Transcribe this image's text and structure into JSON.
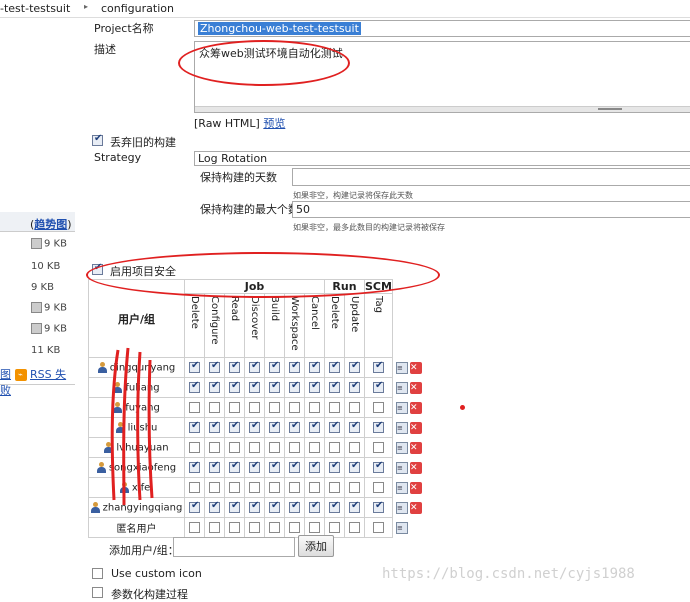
{
  "breadcrumb": {
    "project": "-test-testsuit",
    "page": "configuration"
  },
  "form": {
    "project_label": "Project名称",
    "project_value": "Zhongchou-web-test-testsuit",
    "desc_label": "描述",
    "desc_value": "众筹web测试环境自动化测试",
    "raw_html": "[Raw HTML]",
    "preview": "预览",
    "discard_label": "丢弃旧的构建",
    "strategy_label": "Strategy",
    "strategy_value": "Log Rotation",
    "days_label": "保持构建的天数",
    "days_value": "",
    "days_hint": "如果非空，构建记录将保存此天数",
    "max_label": "保持构建的最大个数",
    "max_value": "50",
    "max_hint": "如果非空，最多此数目的构建记录将被保存",
    "security_label": "启用项目安全",
    "add_user_label": "添加用户/组：",
    "add_button": "添加",
    "custom_icon_label": "Use custom icon",
    "param_label": "参数化构建过程"
  },
  "sidebar": {
    "trend": "趋势图",
    "sizes": [
      "9 KB",
      "10 KB",
      "9 KB",
      "9 KB",
      "9 KB",
      "11 KB"
    ],
    "legend": "图",
    "rss": "RSS 失败"
  },
  "matrix": {
    "user_header": "用户/组",
    "groups": [
      "Job",
      "Run",
      "SCM"
    ],
    "columns": [
      "Delete",
      "Configure",
      "Read",
      "Discover",
      "Build",
      "Workspace",
      "Cancel",
      "Delete",
      "Update",
      "Tag"
    ],
    "rows": [
      {
        "name": "dingqunyang",
        "checks": [
          1,
          1,
          1,
          1,
          1,
          1,
          1,
          1,
          1,
          1
        ]
      },
      {
        "name": "fuliang",
        "checks": [
          1,
          1,
          1,
          1,
          1,
          1,
          1,
          1,
          1,
          1
        ]
      },
      {
        "name": "fuyang",
        "checks": [
          0,
          0,
          0,
          0,
          0,
          0,
          0,
          0,
          0,
          0
        ]
      },
      {
        "name": "liushu",
        "checks": [
          1,
          1,
          1,
          1,
          1,
          1,
          1,
          1,
          1,
          1
        ]
      },
      {
        "name": "lvhuayuan",
        "checks": [
          0,
          0,
          0,
          0,
          0,
          0,
          0,
          0,
          0,
          0
        ]
      },
      {
        "name": "songxiaofeng",
        "checks": [
          1,
          1,
          1,
          1,
          1,
          1,
          1,
          1,
          1,
          1
        ]
      },
      {
        "name": "xifei",
        "checks": [
          0,
          0,
          0,
          0,
          0,
          0,
          0,
          0,
          0,
          0
        ]
      },
      {
        "name": "zhangyingqiang",
        "checks": [
          1,
          1,
          1,
          1,
          1,
          1,
          1,
          1,
          1,
          1
        ]
      },
      {
        "name": "匿名用户",
        "checks": [
          0,
          0,
          0,
          0,
          0,
          0,
          0,
          0,
          0,
          0
        ]
      }
    ]
  },
  "watermark": "https://blog.csdn.net/cyjs1988"
}
